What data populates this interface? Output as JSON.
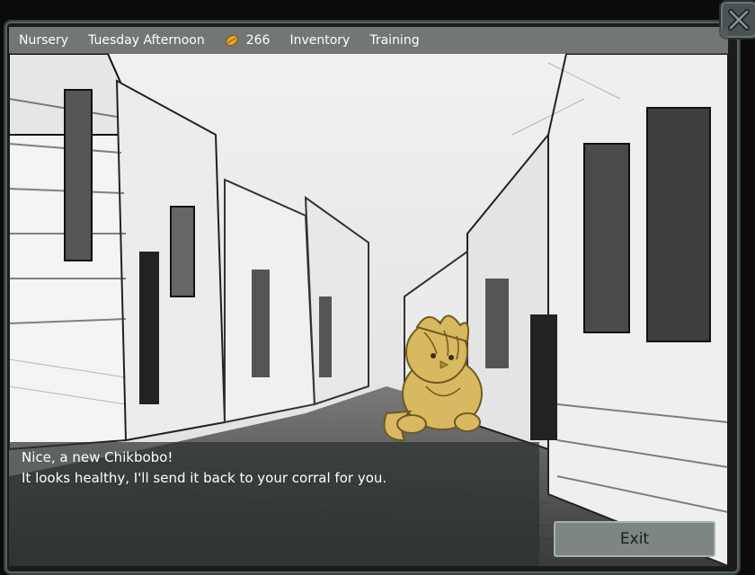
{
  "topbar": {
    "location": "Nursery",
    "time": "Tuesday Afternoon",
    "currency_amount": "266",
    "currency_icon": "seed-icon",
    "inventory_label": "Inventory",
    "training_label": "Training"
  },
  "dialog": {
    "line1": "Nice, a new Chikbobo!",
    "line2": "It looks healthy, I'll send it back to your corral for you."
  },
  "exit_label": "Exit",
  "colors": {
    "creature": "#d8b860",
    "panel": "#5a6060"
  }
}
